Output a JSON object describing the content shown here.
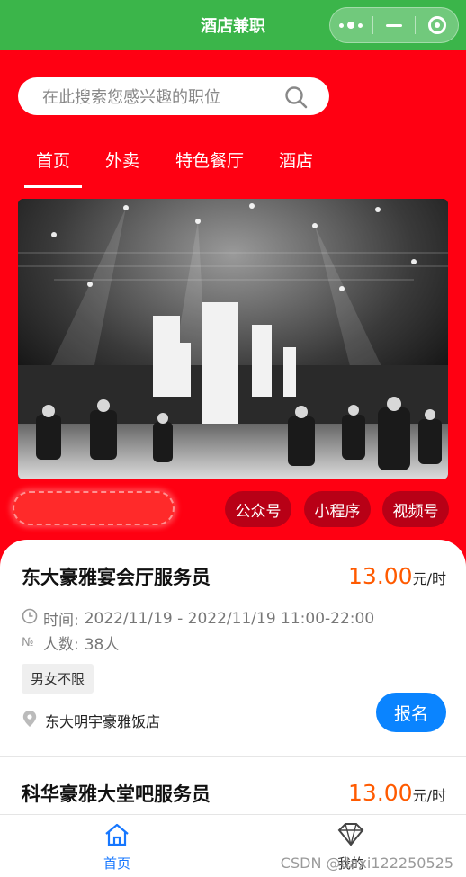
{
  "window": {
    "title": "酒店兼职"
  },
  "search": {
    "placeholder": "在此搜索您感兴趣的职位"
  },
  "tabs": [
    {
      "label": "首页",
      "active": true
    },
    {
      "label": "外卖",
      "active": false
    },
    {
      "label": "特色餐厅",
      "active": false
    },
    {
      "label": "酒店",
      "active": false
    }
  ],
  "channels": [
    "公众号",
    "小程序",
    "视频号"
  ],
  "jobs": [
    {
      "title": "东大豪雅宴会厅服务员",
      "price": "13.00",
      "unit": "元/时",
      "time_label": "时间:",
      "time_value": "2022/11/19 - 2022/11/19 11:00-22:00",
      "people_label": "人数:",
      "people_value": "38人",
      "tag": "男女不限",
      "address": "东大明宇豪雅饭店",
      "signup_label": "报名"
    },
    {
      "title": "科华豪雅大堂吧服务员",
      "price": "13.00",
      "unit": "元/时"
    }
  ],
  "tabbar": {
    "home_label": "首页",
    "mine_label": "我的"
  },
  "watermark": "CSDN @daxi122250525",
  "colors": {
    "titlebar": "#3bb54a",
    "hero_red": "#ff0012",
    "price": "#ff5a00",
    "primary_blue": "#0a84ff"
  }
}
